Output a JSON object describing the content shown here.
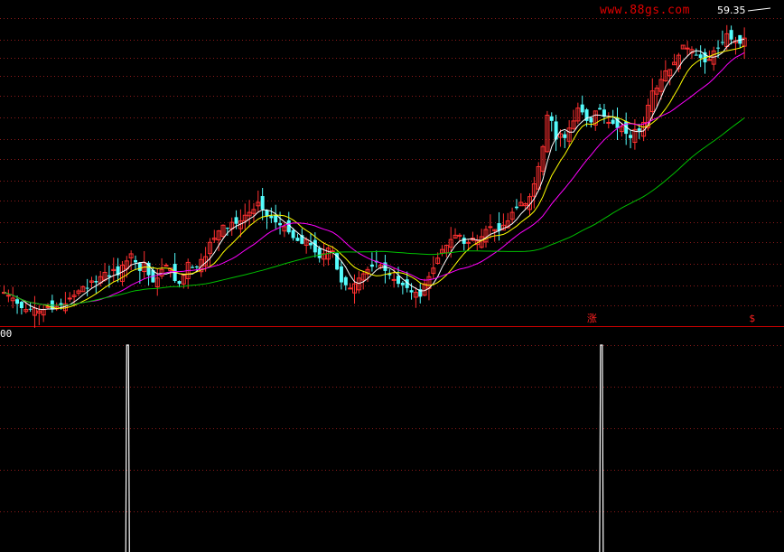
{
  "watermark": "www.88gs.com",
  "high_label": "59.35",
  "sub_axis_label": "00",
  "markers": [
    {
      "text": "涨",
      "bar_index": 134
    },
    {
      "text": "$",
      "bar_index": 171
    }
  ],
  "colors": {
    "background": "#000000",
    "grid": "#8b1a1a",
    "separator": "#cc0000",
    "up_candle": "#ff3030",
    "down_candle": "#54fcfc",
    "ma_short": "#ffffff",
    "ma_mid": "#ffff00",
    "ma_long": "#ff00ff",
    "ma_longest": "#00c000",
    "signal": "#ffffff"
  },
  "chart_data": [
    {
      "type": "candlestick",
      "title": "",
      "price_range": [
        38.5,
        60.0
      ],
      "high_marker": 59.35,
      "grid": true,
      "close": [
        40.8,
        40.6,
        40.4,
        40.0,
        39.7,
        39.6,
        39.6,
        39.7,
        39.5,
        39.6,
        39.8,
        39.6,
        39.8,
        39.9,
        40.0,
        40.4,
        40.6,
        40.9,
        41.2,
        41.1,
        41.6,
        41.5,
        41.9,
        42.2,
        41.9,
        42.4,
        42.0,
        42.7,
        43.0,
        43.5,
        42.9,
        42.3,
        42.9,
        42.0,
        41.5,
        41.8,
        42.4,
        42.7,
        42.5,
        41.6,
        41.4,
        42.0,
        42.9,
        42.5,
        42.6,
        43.1,
        43.3,
        44.3,
        44.6,
        45.1,
        45.5,
        45.3,
        45.7,
        45.6,
        45.8,
        46.2,
        46.4,
        46.6,
        47.1,
        46.6,
        46.1,
        46.0,
        45.7,
        45.5,
        45.4,
        45.0,
        44.6,
        44.4,
        44.2,
        44.5,
        44.1,
        43.6,
        43.2,
        43.5,
        43.9,
        43.7,
        42.4,
        41.5,
        41.3,
        41.1,
        41.4,
        41.8,
        42.1,
        42.4,
        42.6,
        42.9,
        42.7,
        42.3,
        42.0,
        41.7,
        41.4,
        41.3,
        41.1,
        40.8,
        40.8,
        40.5,
        41.4,
        41.9,
        42.5,
        43.2,
        43.8,
        44.1,
        44.5,
        44.8,
        44.8,
        44.2,
        44.3,
        44.6,
        44.4,
        44.7,
        45.2,
        45.4,
        45.2,
        45.1,
        45.5,
        45.8,
        46.4,
        46.7,
        47.1,
        47.0,
        47.5,
        48.4,
        49.6,
        51.0,
        53.2,
        52.8,
        51.5,
        51.9,
        51.6,
        52.3,
        52.8,
        53.7,
        53.4,
        52.8,
        52.7,
        53.5,
        53.6,
        53.1,
        52.7,
        52.6,
        52.3,
        52.4,
        51.9,
        51.6,
        52.2,
        52.1,
        52.7,
        53.9,
        54.9,
        55.1,
        55.7,
        56.3,
        56.4,
        56.9,
        57.4,
        58.1,
        57.9,
        57.8,
        57.4,
        57.2,
        56.9,
        57.1,
        57.7,
        57.9,
        58.3,
        58.9,
        58.5,
        58.4,
        58.2,
        58.6
      ],
      "moving_averages": [
        "MA5",
        "MA10",
        "MA20",
        "MA60"
      ]
    },
    {
      "type": "bar",
      "title": "",
      "signals": [
        {
          "bar_index": 45,
          "value": 1
        },
        {
          "bar_index": 217,
          "value": 1
        }
      ],
      "ylim": [
        0,
        1
      ]
    }
  ]
}
